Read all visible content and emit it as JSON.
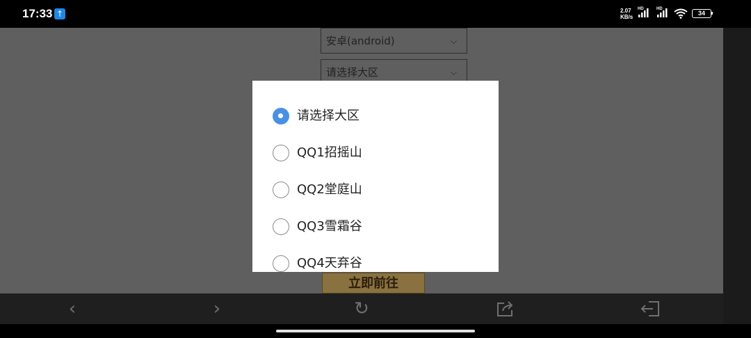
{
  "status_bar": {
    "time": "17:33",
    "upload_icon": "↑",
    "net_speed_value": "2.07",
    "net_speed_unit": "KB/s",
    "signal_1_label": "HD",
    "signal_2_label": "HD",
    "battery_level": "34"
  },
  "page": {
    "platform_select": "安卓(android)",
    "region_select": "请选择大区",
    "go_button": "立即前往"
  },
  "dialog": {
    "options": [
      {
        "label": "请选择大区",
        "checked": true
      },
      {
        "label": "QQ1招摇山",
        "checked": false
      },
      {
        "label": "QQ2堂庭山",
        "checked": false
      },
      {
        "label": "QQ3雪霜谷",
        "checked": false
      },
      {
        "label": "QQ4天弃谷",
        "checked": false
      }
    ]
  },
  "nav_bar": {
    "back_icon": "‹",
    "forward_icon": "›",
    "refresh_icon": "↻",
    "share_icon": "share-icon",
    "exit_icon": "exit-icon"
  },
  "colors": {
    "radio_selected": "#4a90e2",
    "overlay_dim": "#5f5f5f",
    "go_button_bg": "#8a7140"
  }
}
